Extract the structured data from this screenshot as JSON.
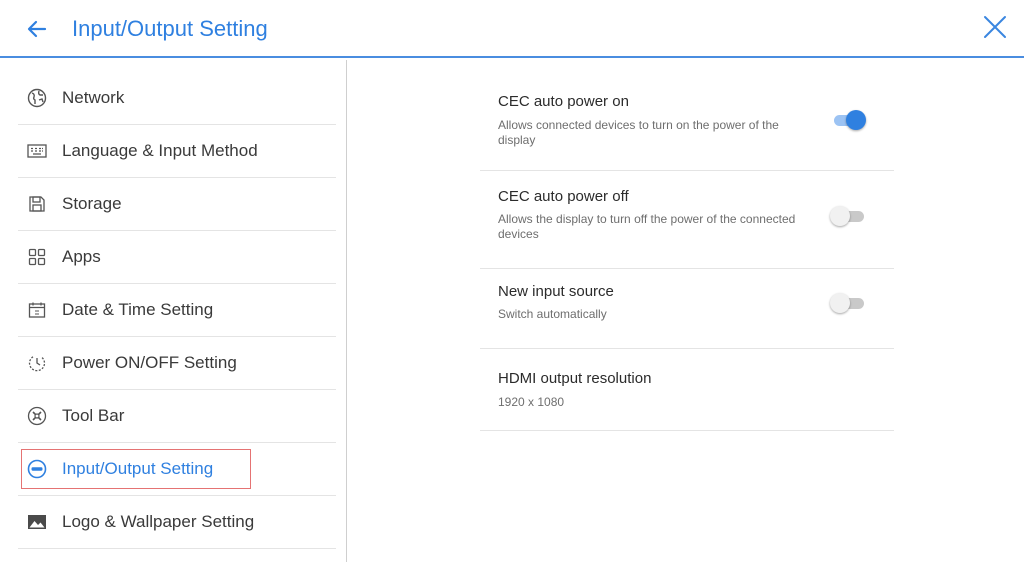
{
  "header": {
    "title": "Input/Output Setting",
    "accent_color": "#2f80e0",
    "back_icon": "arrow-left-icon",
    "close_icon": "close-icon"
  },
  "sidebar": {
    "items": [
      {
        "label": "Network",
        "icon": "globe-icon",
        "active": false
      },
      {
        "label": "Language & Input Method",
        "icon": "keyboard-icon",
        "active": false
      },
      {
        "label": "Storage",
        "icon": "save-icon",
        "active": false
      },
      {
        "label": "Apps",
        "icon": "apps-grid-icon",
        "active": false
      },
      {
        "label": "Date & Time Setting",
        "icon": "calendar-icon",
        "active": false
      },
      {
        "label": "Power ON/OFF Setting",
        "icon": "power-icon",
        "active": false
      },
      {
        "label": "Tool Bar",
        "icon": "tools-icon",
        "active": false
      },
      {
        "label": "Input/Output Setting",
        "icon": "input-output-icon",
        "active": true
      },
      {
        "label": "Logo & Wallpaper Setting",
        "icon": "image-icon",
        "active": false
      }
    ]
  },
  "settings": [
    {
      "title": "CEC auto power on",
      "description": "Allows connected devices to turn on the power of the display",
      "toggle": true
    },
    {
      "title": "CEC auto power off",
      "description": "Allows the display to turn off the power of the connected devices",
      "toggle": false
    },
    {
      "title": "New input source",
      "description": "Switch automatically",
      "toggle": false
    },
    {
      "title": "HDMI output resolution",
      "description": "1920 x 1080"
    }
  ]
}
